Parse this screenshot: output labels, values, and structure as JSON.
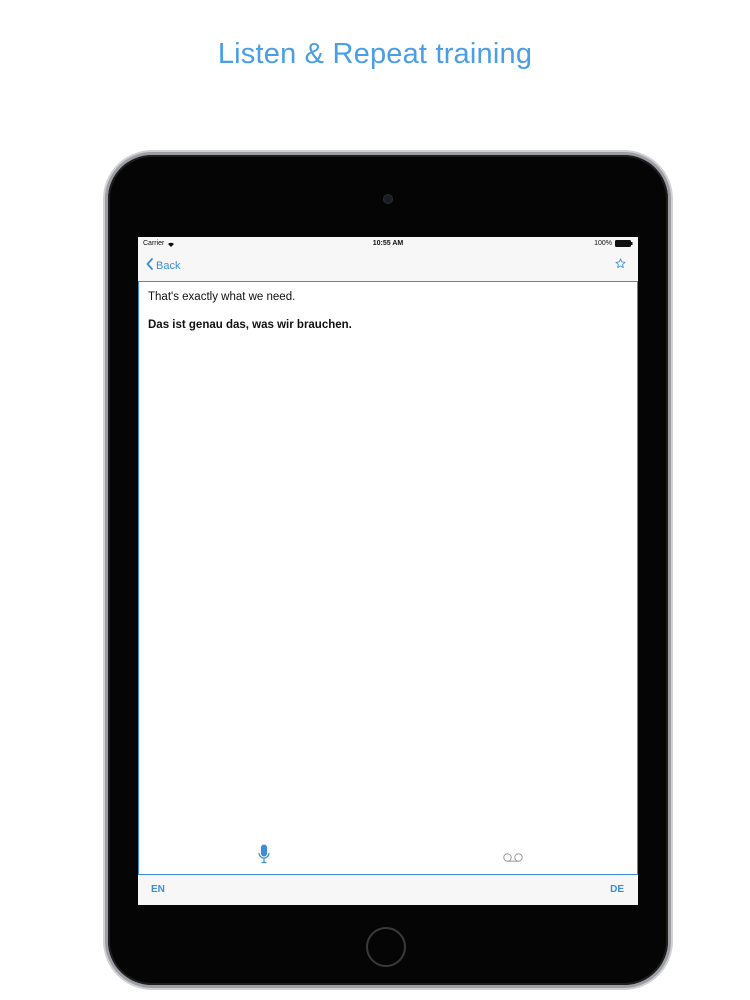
{
  "promo": {
    "title": "Listen & Repeat training"
  },
  "status_bar": {
    "carrier": "Carrier",
    "time": "10:55 AM",
    "battery": "100%",
    "icons": [
      "wifi-icon",
      "battery-icon"
    ]
  },
  "nav": {
    "back_label": "Back",
    "back_icon": "chevron-left-icon",
    "star_icon": "star-icon"
  },
  "phrase": {
    "source": "That's exactly what we need.",
    "translation": "Das ist genau das, was wir brauchen."
  },
  "controls": {
    "mic_icon": "microphone-icon",
    "voicemail_icon": "voicemail-icon"
  },
  "languages": {
    "left": "EN",
    "right": "DE"
  },
  "colors": {
    "accent": "#3a8ed8",
    "promo_title": "#4a9ee6",
    "bezel": "#050505"
  }
}
